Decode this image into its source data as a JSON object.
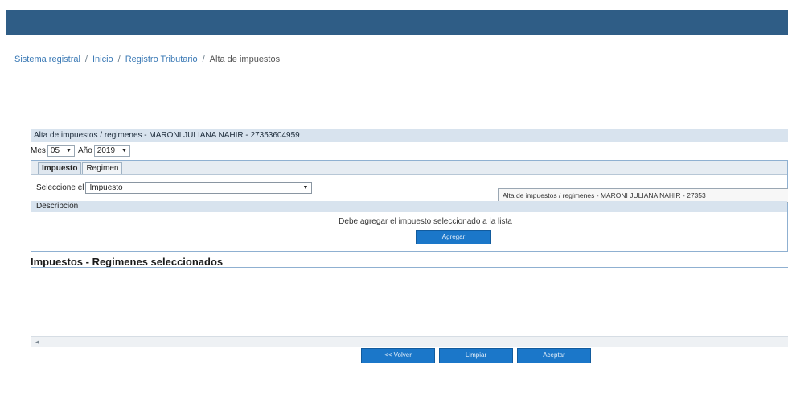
{
  "breadcrumb": {
    "items": [
      "Sistema registral",
      "Inicio",
      "Registro Tributario"
    ],
    "separator": "/",
    "current": "Alta de impuestos"
  },
  "panel": {
    "title": "Alta de impuestos / regimenes - MARONI JULIANA NAHIR - 27353604959"
  },
  "period": {
    "month_label": "Mes",
    "month_value": "05",
    "year_label": "Año",
    "year_value": "2019"
  },
  "tabs": [
    {
      "label": "Impuesto",
      "active": true
    },
    {
      "label": "Regimen",
      "active": false
    }
  ],
  "form": {
    "select_label": "Seleccione el",
    "select_value": "Impuesto",
    "description_label": "Descripción",
    "hint": "Debe agregar el impuesto seleccionado a la lista",
    "add_button": "Agregar"
  },
  "tooltip": {
    "text": "Alta de impuestos / regimenes - MARONI JULIANA NAHIR - 27353"
  },
  "selected_list": {
    "title": "Impuestos - Regimenes seleccionados"
  },
  "actions": {
    "back": "<< Volver",
    "clear": "Limpiar",
    "accept": "Aceptar"
  },
  "colors": {
    "header": "#2f5d86",
    "button": "#1b77c9",
    "section_bar": "#d8e3ee"
  }
}
